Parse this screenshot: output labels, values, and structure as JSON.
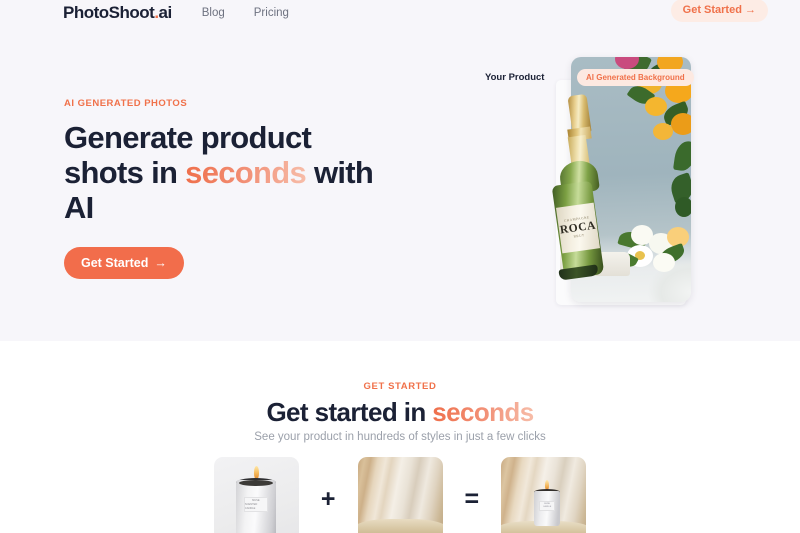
{
  "nav": {
    "logo_main": "PhotoShoot",
    "logo_dot": ".",
    "logo_suffix": "ai",
    "links": [
      {
        "label": "Blog"
      },
      {
        "label": "Pricing"
      }
    ],
    "cta_label": "Get Started →"
  },
  "hero": {
    "eyebrow": "AI GENERATED PHOTOS",
    "headline_part1": "Generate product shots in ",
    "headline_highlight": "seconds",
    "headline_part2": " with AI",
    "cta_label": "Get Started",
    "cta_arrow": "→",
    "product_label": "Your Product",
    "background_badge": "AI Generated Background",
    "bottle": {
      "brand": "ROCA",
      "sub_top": "CHAMPAGNE",
      "sub_bottom": "BRUT"
    }
  },
  "get_started": {
    "eyebrow": "GET STARTED",
    "title_part1": "Get started in ",
    "title_highlight": "seconds",
    "subtitle": "See your product in hundreds of styles in just a few clicks",
    "operator_plus": "+",
    "operator_equals": "=",
    "steps": [
      {
        "alt": "product-photo-candle",
        "label_top": "MUSE",
        "label_bottom": "SCENTED CANDLE"
      },
      {
        "alt": "background-photo-curtain"
      },
      {
        "alt": "result-photo-candle-on-backdrop",
        "label_top": "MUSE",
        "label_bottom": "CANDLE"
      }
    ]
  },
  "colors": {
    "accent": "#f0714a",
    "accent_solid": "#f26d4b",
    "accent_soft": "#fdece5",
    "ink": "#1b2135",
    "muted": "#9ba0aa",
    "hero_bg": "#f7f6fa"
  }
}
